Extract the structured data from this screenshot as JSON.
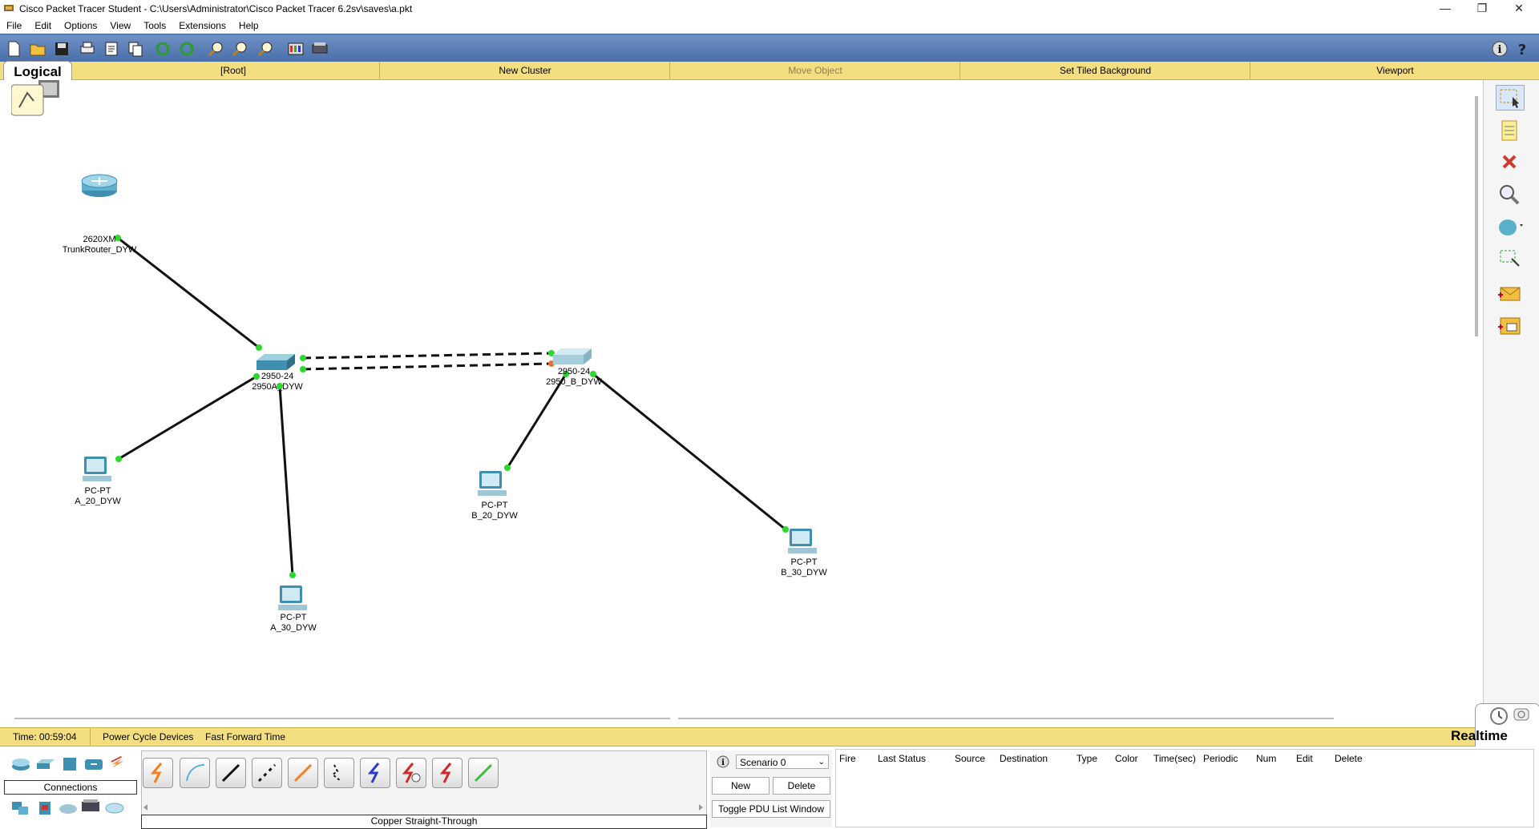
{
  "window": {
    "title": "Cisco Packet Tracer Student - C:\\Users\\Administrator\\Cisco Packet Tracer 6.2sv\\saves\\a.pkt",
    "controls": [
      "minimize",
      "restore",
      "close"
    ]
  },
  "menu": [
    "File",
    "Edit",
    "Options",
    "View",
    "Tools",
    "Extensions",
    "Help"
  ],
  "toolbar": {
    "icons": [
      "new-file-icon",
      "open-folder-icon",
      "save-icon",
      "print-icon",
      "activity-wizard-icon",
      "copy-icon",
      "undo-icon",
      "redo-icon",
      "zoom-in-icon",
      "zoom-reset-icon",
      "zoom-out-icon",
      "palette-icon",
      "custom-device-icon"
    ],
    "right_icons": [
      "info-icon",
      "help-icon"
    ]
  },
  "workspace_bar": {
    "tab": "Logical",
    "items": [
      "[Root]",
      "New Cluster",
      "Move Object",
      "Set Tiled Background",
      "Viewport"
    ]
  },
  "devices": [
    {
      "model": "2620XM",
      "name": "TrunkRouter_DYW",
      "type": "router"
    },
    {
      "model": "2950-24",
      "name": "2950A_DYW",
      "type": "switch"
    },
    {
      "model": "2950-24",
      "name": "2950_B_DYW",
      "type": "switch"
    },
    {
      "model": "PC-PT",
      "name": "A_20_DYW",
      "type": "pc"
    },
    {
      "model": "PC-PT",
      "name": "A_30_DYW",
      "type": "pc"
    },
    {
      "model": "PC-PT",
      "name": "B_20_DYW",
      "type": "pc"
    },
    {
      "model": "PC-PT",
      "name": "B_30_DYW",
      "type": "pc"
    }
  ],
  "right_tools": [
    "select-icon",
    "note-icon",
    "delete-icon",
    "inspect-icon",
    "draw-shape-icon",
    "resize-icon",
    "add-simple-pdu-icon",
    "add-complex-pdu-icon"
  ],
  "status_bar": {
    "time": "Time: 00:59:04",
    "power_cycle": "Power Cycle Devices",
    "fast_forward": "Fast Forward Time",
    "mode": "Realtime"
  },
  "device_panel": {
    "category_label": "Connections",
    "selected_cable": "Copper Straight-Through",
    "cables": [
      "automatic-cable-icon",
      "console-cable-icon",
      "copper-straight-through-icon",
      "copper-cross-over-icon",
      "fiber-icon",
      "phone-cable-icon",
      "coaxial-icon",
      "serial-dce-icon",
      "serial-dte-icon",
      "octal-cable-icon"
    ]
  },
  "scenario": {
    "selected": "Scenario 0",
    "new_label": "New",
    "delete_label": "Delete",
    "toggle_label": "Toggle PDU List Window"
  },
  "pdu_table": {
    "columns": [
      "Fire",
      "Last Status",
      "Source",
      "Destination",
      "Type",
      "Color",
      "Time(sec)",
      "Periodic",
      "Num",
      "Edit",
      "Delete"
    ]
  }
}
